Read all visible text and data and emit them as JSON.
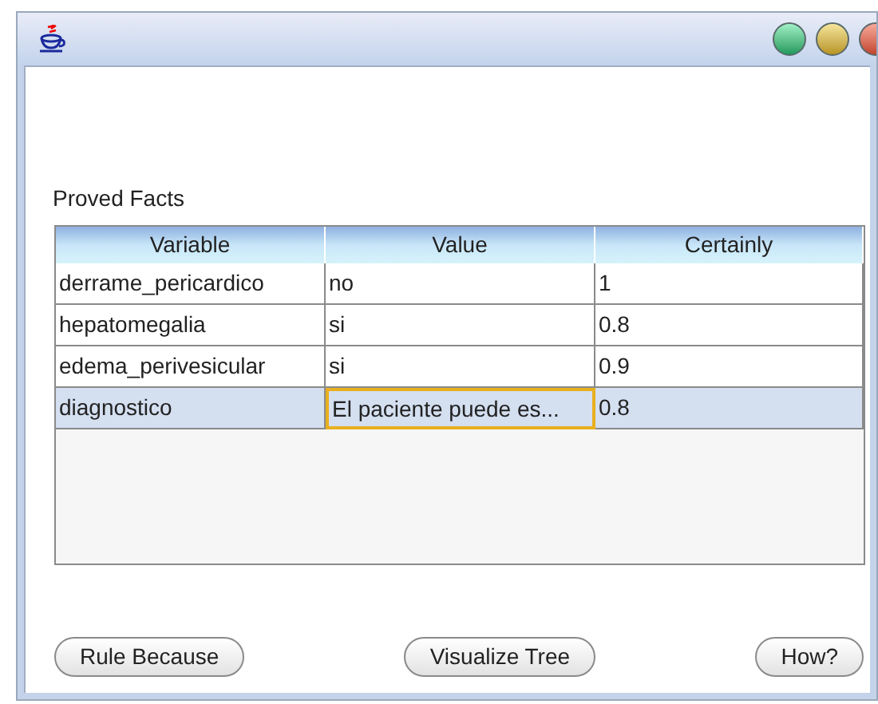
{
  "window": {
    "controls": [
      {
        "kind": "green"
      },
      {
        "kind": "yellow"
      },
      {
        "kind": "red"
      }
    ]
  },
  "section_label": "Proved Facts",
  "table": {
    "columns": [
      "Variable",
      "Value",
      "Certainly"
    ],
    "rows": [
      {
        "selected": false,
        "cells": [
          {
            "text": "derrame_pericardico",
            "focused": false
          },
          {
            "text": "no",
            "focused": false
          },
          {
            "text": "1",
            "focused": false
          }
        ]
      },
      {
        "selected": false,
        "cells": [
          {
            "text": "hepatomegalia",
            "focused": false
          },
          {
            "text": "si",
            "focused": false
          },
          {
            "text": "0.8",
            "focused": false
          }
        ]
      },
      {
        "selected": false,
        "cells": [
          {
            "text": "edema_perivesicular",
            "focused": false
          },
          {
            "text": "si",
            "focused": false
          },
          {
            "text": "0.9",
            "focused": false
          }
        ]
      },
      {
        "selected": true,
        "cells": [
          {
            "text": "diagnostico",
            "focused": false
          },
          {
            "text": "El paciente puede es...",
            "focused": true
          },
          {
            "text": "0.8",
            "focused": false
          }
        ]
      }
    ]
  },
  "buttons": [
    "Rule Because",
    "Visualize Tree",
    "How?"
  ]
}
